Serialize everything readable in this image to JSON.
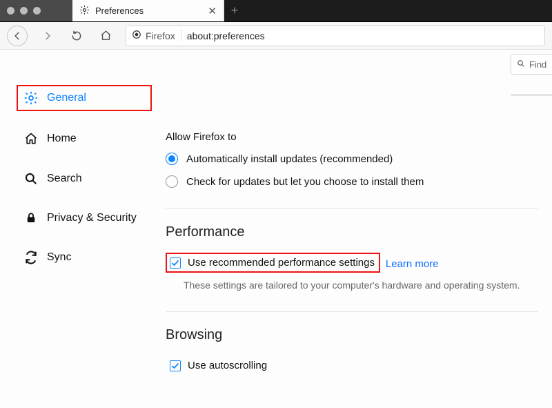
{
  "tab": {
    "title": "Preferences"
  },
  "urlbar": {
    "product": "Firefox",
    "address": "about:preferences"
  },
  "find": {
    "placeholder": "Find"
  },
  "sidebar": {
    "items": [
      {
        "label": "General"
      },
      {
        "label": "Home"
      },
      {
        "label": "Search"
      },
      {
        "label": "Privacy & Security"
      },
      {
        "label": "Sync"
      }
    ]
  },
  "updates": {
    "intro": "Allow Firefox to",
    "auto": "Automatically install updates (recommended)",
    "check": "Check for updates but let you choose to install them"
  },
  "performance": {
    "heading": "Performance",
    "recommended": "Use recommended performance settings",
    "learn_more": "Learn more",
    "help": "These settings are tailored to your computer's hardware and operating system."
  },
  "browsing": {
    "heading": "Browsing",
    "autoscroll": "Use autoscrolling"
  }
}
